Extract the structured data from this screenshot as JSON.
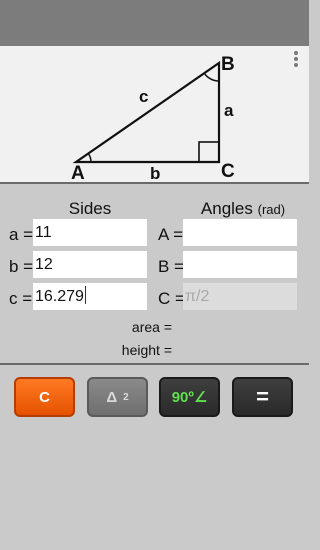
{
  "diagram": {
    "vertices": {
      "a_vertex": "A",
      "b_vertex": "B",
      "c_vertex": "C"
    },
    "sides": {
      "a": "a",
      "b": "b",
      "c": "c"
    }
  },
  "headings": {
    "sides": "Sides",
    "angles": "Angles",
    "angles_unit": "(rad)"
  },
  "sides": [
    {
      "label": "a =",
      "value": "11"
    },
    {
      "label": "b =",
      "value": "12"
    },
    {
      "label": "c =",
      "value": "16.279"
    }
  ],
  "angles": [
    {
      "label": "A =",
      "value": ""
    },
    {
      "label": "B =",
      "value": ""
    },
    {
      "label": "C =",
      "value": "π/2"
    }
  ],
  "results": {
    "area_label": "area =",
    "height_label": "height ="
  },
  "buttons": {
    "clear": "C",
    "area": "Δ",
    "area_sup": "2",
    "right_angle": "90º∠",
    "equals": "="
  },
  "colors": {
    "clear_button": "#f26a0e",
    "right_angle_text": "#5ee04d",
    "background": "#cacaca"
  }
}
